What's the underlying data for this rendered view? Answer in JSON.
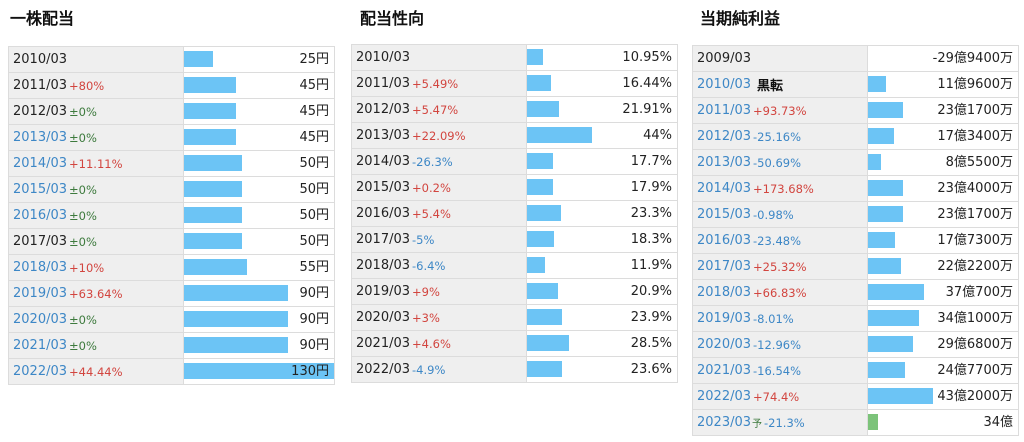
{
  "panels": [
    {
      "title": "一株配当",
      "rows": [
        {
          "year": "2010/03",
          "change": "",
          "value": "25円",
          "bar": 25,
          "blue": false
        },
        {
          "year": "2011/03",
          "change": "+80%",
          "value": "45円",
          "bar": 45,
          "blue": false
        },
        {
          "year": "2012/03",
          "change": "±0%",
          "value": "45円",
          "bar": 45,
          "blue": false
        },
        {
          "year": "2013/03",
          "change": "±0%",
          "value": "45円",
          "bar": 45,
          "blue": true
        },
        {
          "year": "2014/03",
          "change": "+11.11%",
          "value": "50円",
          "bar": 50,
          "blue": true
        },
        {
          "year": "2015/03",
          "change": "±0%",
          "value": "50円",
          "bar": 50,
          "blue": true
        },
        {
          "year": "2016/03",
          "change": "±0%",
          "value": "50円",
          "bar": 50,
          "blue": true
        },
        {
          "year": "2017/03",
          "change": "±0%",
          "value": "50円",
          "bar": 50,
          "blue": false
        },
        {
          "year": "2018/03",
          "change": "+10%",
          "value": "55円",
          "bar": 55,
          "blue": true
        },
        {
          "year": "2019/03",
          "change": "+63.64%",
          "value": "90円",
          "bar": 90,
          "blue": true
        },
        {
          "year": "2020/03",
          "change": "±0%",
          "value": "90円",
          "bar": 90,
          "blue": true
        },
        {
          "year": "2021/03",
          "change": "±0%",
          "value": "90円",
          "bar": 90,
          "blue": true
        },
        {
          "year": "2022/03",
          "change": "+44.44%",
          "value": "130円",
          "bar": 130,
          "blue": true
        }
      ]
    },
    {
      "title": "配当性向",
      "rows": [
        {
          "year": "2010/03",
          "change": "",
          "value": "10.95%",
          "bar": 10.95,
          "blue": false
        },
        {
          "year": "2011/03",
          "change": "+5.49%",
          "value": "16.44%",
          "bar": 16.44,
          "blue": false
        },
        {
          "year": "2012/03",
          "change": "+5.47%",
          "value": "21.91%",
          "bar": 21.91,
          "blue": false
        },
        {
          "year": "2013/03",
          "change": "+22.09%",
          "value": "44%",
          "bar": 44,
          "blue": false
        },
        {
          "year": "2014/03",
          "change": "-26.3%",
          "value": "17.7%",
          "bar": 17.7,
          "blue": false
        },
        {
          "year": "2015/03",
          "change": "+0.2%",
          "value": "17.9%",
          "bar": 17.9,
          "blue": false
        },
        {
          "year": "2016/03",
          "change": "+5.4%",
          "value": "23.3%",
          "bar": 23.3,
          "blue": false
        },
        {
          "year": "2017/03",
          "change": "-5%",
          "value": "18.3%",
          "bar": 18.3,
          "blue": false
        },
        {
          "year": "2018/03",
          "change": "-6.4%",
          "value": "11.9%",
          "bar": 11.9,
          "blue": false
        },
        {
          "year": "2019/03",
          "change": "+9%",
          "value": "20.9%",
          "bar": 20.9,
          "blue": false
        },
        {
          "year": "2020/03",
          "change": "+3%",
          "value": "23.9%",
          "bar": 23.9,
          "blue": false
        },
        {
          "year": "2021/03",
          "change": "+4.6%",
          "value": "28.5%",
          "bar": 28.5,
          "blue": false
        },
        {
          "year": "2022/03",
          "change": "-4.9%",
          "value": "23.6%",
          "bar": 23.6,
          "blue": false
        }
      ]
    },
    {
      "title": "当期純利益",
      "rows": [
        {
          "year": "2009/03",
          "change": "",
          "value": "-29億9400万",
          "bar": 0,
          "blue": false
        },
        {
          "year": "2010/03",
          "change": "",
          "note": "黒転",
          "value": "11億9600万",
          "bar": 11.96,
          "blue": true
        },
        {
          "year": "2011/03",
          "change": "+93.73%",
          "value": "23億1700万",
          "bar": 23.17,
          "blue": true
        },
        {
          "year": "2012/03",
          "change": "-25.16%",
          "value": "17億3400万",
          "bar": 17.34,
          "blue": true
        },
        {
          "year": "2013/03",
          "change": "-50.69%",
          "value": "8億5500万",
          "bar": 8.55,
          "blue": true
        },
        {
          "year": "2014/03",
          "change": "+173.68%",
          "value": "23億4000万",
          "bar": 23.4,
          "blue": true
        },
        {
          "year": "2015/03",
          "change": "-0.98%",
          "value": "23億1700万",
          "bar": 23.17,
          "blue": true
        },
        {
          "year": "2016/03",
          "change": "-23.48%",
          "value": "17億7300万",
          "bar": 17.73,
          "blue": true
        },
        {
          "year": "2017/03",
          "change": "+25.32%",
          "value": "22億2200万",
          "bar": 22.22,
          "blue": true
        },
        {
          "year": "2018/03",
          "change": "+66.83%",
          "value": "37億700万",
          "bar": 37.07,
          "blue": true
        },
        {
          "year": "2019/03",
          "change": "-8.01%",
          "value": "34億1000万",
          "bar": 34.1,
          "blue": true
        },
        {
          "year": "2020/03",
          "change": "-12.96%",
          "value": "29億6800万",
          "bar": 29.68,
          "blue": true
        },
        {
          "year": "2021/03",
          "change": "-16.54%",
          "value": "24億7700万",
          "bar": 24.77,
          "blue": true
        },
        {
          "year": "2022/03",
          "change": "+74.4%",
          "value": "43億2000万",
          "bar": 43.2,
          "blue": true
        },
        {
          "year": "2023/03",
          "yo": "予",
          "change": "-21.3%",
          "value": "34億",
          "bar": 34,
          "blue": true,
          "forecast": true
        }
      ]
    }
  ],
  "colors": {
    "bar": "#6cc4f5",
    "forecast_bar": "#7cc37a",
    "positive": "#d2453f",
    "negative": "#3d87c6",
    "zero": "#3d7a3d"
  }
}
